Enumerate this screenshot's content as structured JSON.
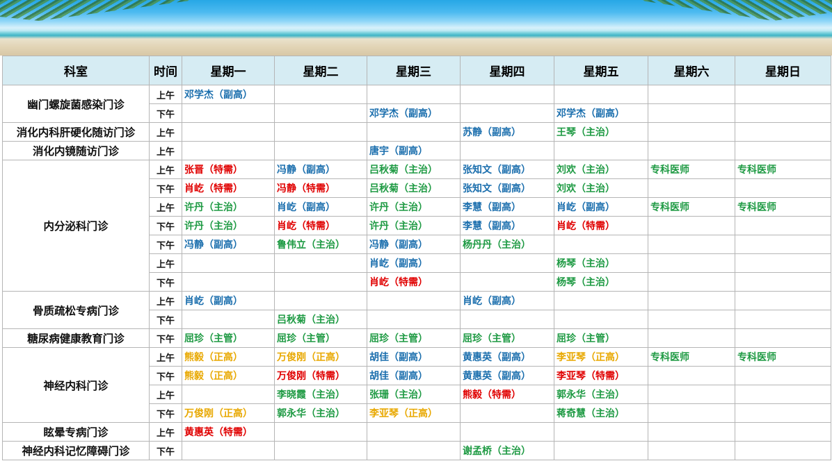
{
  "header": [
    "科室",
    "时间",
    "星期一",
    "星期二",
    "星期三",
    "星期四",
    "星期五",
    "星期六",
    "星期日"
  ],
  "colors": {
    "blue": "#1a6ead",
    "green": "#1e9a43",
    "red": "#e00000",
    "gold": "#e8a800",
    "header_bg": "#d6ecf3"
  },
  "groups": [
    {
      "dept": "幽门螺旋菌感染门诊",
      "rows": [
        {
          "time": "上午",
          "cells": [
            {
              "t": "邓学杰（副高）",
              "c": "blue"
            },
            null,
            null,
            null,
            null,
            null,
            null
          ]
        },
        {
          "time": "下午",
          "cells": [
            null,
            null,
            {
              "t": "邓学杰（副高）",
              "c": "blue"
            },
            null,
            {
              "t": "邓学杰（副高）",
              "c": "blue"
            },
            null,
            null
          ]
        }
      ]
    },
    {
      "dept": "消化内科肝硬化随访门诊",
      "rows": [
        {
          "time": "上午",
          "cells": [
            null,
            null,
            null,
            {
              "t": "苏静（副高）",
              "c": "blue"
            },
            {
              "t": "王琴（主治）",
              "c": "green"
            },
            null,
            null
          ]
        }
      ]
    },
    {
      "dept": "消化内镜随访门诊",
      "rows": [
        {
          "time": "上午",
          "cells": [
            null,
            null,
            {
              "t": "唐宇（副高）",
              "c": "blue"
            },
            null,
            null,
            null,
            null
          ]
        }
      ]
    },
    {
      "dept": "内分泌科门诊",
      "rows": [
        {
          "time": "上午",
          "cells": [
            {
              "t": "张晋（特需）",
              "c": "red"
            },
            {
              "t": "冯静（副高）",
              "c": "blue"
            },
            {
              "t": "吕秋菊（主治）",
              "c": "green"
            },
            {
              "t": "张知文（副高）",
              "c": "blue"
            },
            {
              "t": "刘欢（主治）",
              "c": "green"
            },
            {
              "t": "专科医师",
              "c": "green"
            },
            {
              "t": "专科医师",
              "c": "green"
            }
          ]
        },
        {
          "time": "下午",
          "cells": [
            {
              "t": "肖屹（特需）",
              "c": "red"
            },
            {
              "t": "冯静（特需）",
              "c": "red"
            },
            {
              "t": "吕秋菊（主治）",
              "c": "green"
            },
            {
              "t": "张知文（副高）",
              "c": "blue"
            },
            {
              "t": "刘欢（主治）",
              "c": "green"
            },
            null,
            null
          ]
        },
        {
          "time": "上午",
          "cells": [
            {
              "t": "许丹（主治）",
              "c": "green"
            },
            {
              "t": "肖屹（副高）",
              "c": "blue"
            },
            {
              "t": "许丹（主治）",
              "c": "green"
            },
            {
              "t": "李慧（副高）",
              "c": "blue"
            },
            {
              "t": "肖屹（副高）",
              "c": "blue"
            },
            {
              "t": "专科医师",
              "c": "green"
            },
            {
              "t": "专科医师",
              "c": "green"
            }
          ]
        },
        {
          "time": "下午",
          "cells": [
            {
              "t": "许丹（主治）",
              "c": "green"
            },
            {
              "t": "肖屹（特需）",
              "c": "red"
            },
            {
              "t": "许丹（主治）",
              "c": "green"
            },
            {
              "t": "李慧（副高）",
              "c": "blue"
            },
            {
              "t": "肖屹（特需）",
              "c": "red"
            },
            null,
            null
          ]
        },
        {
          "time": "下午",
          "cells": [
            {
              "t": "冯静（副高）",
              "c": "blue"
            },
            {
              "t": "鲁伟立（主治）",
              "c": "green"
            },
            {
              "t": "冯静（副高）",
              "c": "blue"
            },
            {
              "t": "杨丹丹（主治）",
              "c": "green"
            },
            null,
            null,
            null
          ]
        },
        {
          "time": "上午",
          "cells": [
            null,
            null,
            {
              "t": "肖屹（副高）",
              "c": "blue"
            },
            null,
            {
              "t": "杨琴（主治）",
              "c": "green"
            },
            null,
            null
          ]
        },
        {
          "time": "下午",
          "cells": [
            null,
            null,
            {
              "t": "肖屹（特需）",
              "c": "red"
            },
            null,
            {
              "t": "杨琴（主治）",
              "c": "green"
            },
            null,
            null
          ]
        }
      ]
    },
    {
      "dept": "骨质疏松专病门诊",
      "rows": [
        {
          "time": "上午",
          "cells": [
            {
              "t": "肖屹（副高）",
              "c": "blue"
            },
            null,
            null,
            {
              "t": "肖屹（副高）",
              "c": "blue"
            },
            null,
            null,
            null
          ]
        },
        {
          "time": "下午",
          "cells": [
            null,
            {
              "t": "吕秋菊（主治）",
              "c": "green"
            },
            null,
            null,
            null,
            null,
            null
          ]
        }
      ]
    },
    {
      "dept": "糖尿病健康教育门诊",
      "rows": [
        {
          "time": "下午",
          "cells": [
            {
              "t": "屈珍（主管）",
              "c": "green"
            },
            {
              "t": "屈珍（主管）",
              "c": "green"
            },
            {
              "t": "屈珍（主管）",
              "c": "green"
            },
            {
              "t": "屈珍（主管）",
              "c": "green"
            },
            {
              "t": "屈珍（主管）",
              "c": "green"
            },
            null,
            null
          ]
        }
      ]
    },
    {
      "dept": "神经内科门诊",
      "rows": [
        {
          "time": "上午",
          "cells": [
            {
              "t": "熊毅（正高）",
              "c": "gold"
            },
            {
              "t": "万俊刚（正高）",
              "c": "gold"
            },
            {
              "t": "胡佳（副高）",
              "c": "blue"
            },
            {
              "t": "黄惠英（副高）",
              "c": "blue"
            },
            {
              "t": "李亚琴（正高）",
              "c": "gold"
            },
            {
              "t": "专科医师",
              "c": "green"
            },
            {
              "t": "专科医师",
              "c": "green"
            }
          ]
        },
        {
          "time": "下午",
          "cells": [
            {
              "t": "熊毅（正高）",
              "c": "gold"
            },
            {
              "t": "万俊刚（特需）",
              "c": "red"
            },
            {
              "t": "胡佳（副高）",
              "c": "blue"
            },
            {
              "t": "黄惠英（副高）",
              "c": "blue"
            },
            {
              "t": "李亚琴（特需）",
              "c": "red"
            },
            null,
            null
          ]
        },
        {
          "time": "上午",
          "cells": [
            null,
            {
              "t": "李晓霞（主治）",
              "c": "green"
            },
            {
              "t": "张珊（主治）",
              "c": "green"
            },
            {
              "t": "熊毅（特需）",
              "c": "red"
            },
            {
              "t": "郭永华（主治）",
              "c": "green"
            },
            null,
            null
          ]
        },
        {
          "time": "下午",
          "cells": [
            {
              "t": "万俊刚（正高）",
              "c": "gold"
            },
            {
              "t": "郭永华（主治）",
              "c": "green"
            },
            {
              "t": "李亚琴（正高）",
              "c": "gold"
            },
            null,
            {
              "t": "蒋奇慧（主治）",
              "c": "green"
            },
            null,
            null
          ]
        }
      ]
    },
    {
      "dept": "眩晕专病门诊",
      "rows": [
        {
          "time": "上午",
          "cells": [
            {
              "t": "黄惠英（特需）",
              "c": "red"
            },
            null,
            null,
            null,
            null,
            null,
            null
          ]
        }
      ]
    },
    {
      "dept": "神经内科记忆障碍门诊",
      "rows": [
        {
          "time": "下午",
          "cells": [
            null,
            null,
            null,
            {
              "t": "谢孟桥（主治）",
              "c": "green"
            },
            null,
            null,
            null
          ]
        }
      ]
    }
  ]
}
